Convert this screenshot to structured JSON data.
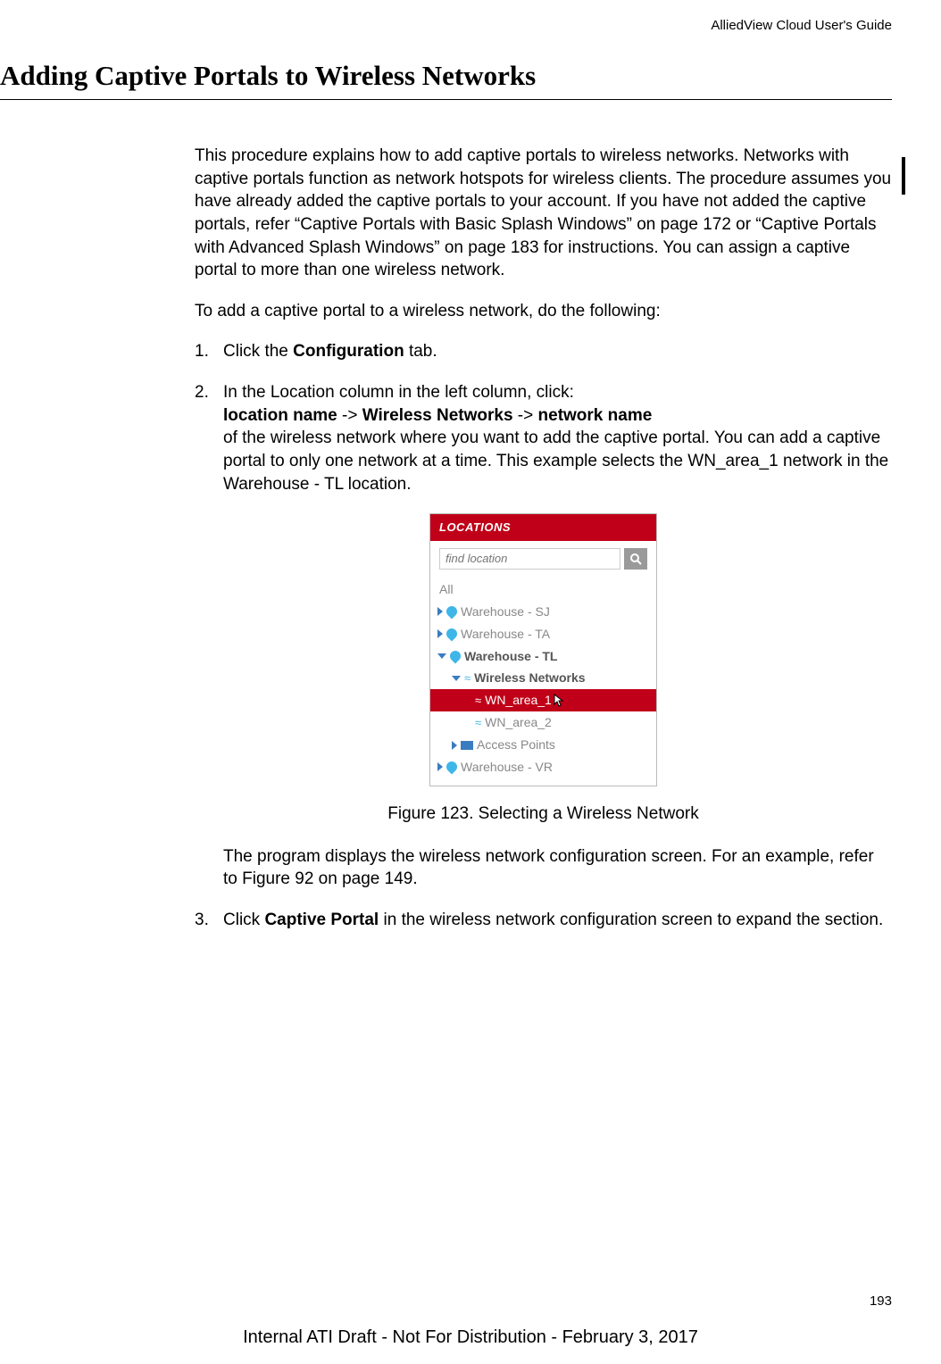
{
  "header": {
    "doc_title": "AlliedView Cloud User's Guide"
  },
  "section": {
    "heading": "Adding Captive Portals to Wireless Networks"
  },
  "intro": {
    "p1": "This procedure explains how to add captive portals to wireless networks. Networks with captive portals function as network hotspots for wireless clients. The procedure assumes you have already added the captive portals to your account. If you have not added the captive portals, refer “Captive Portals with Basic Splash Windows” on page 172 or “Captive Portals with Advanced Splash Windows” on page 183 for instructions. You can assign a captive portal to more than one wireless network.",
    "p2": "To add a captive portal to a wireless network, do the following:"
  },
  "steps": {
    "s1": {
      "num": "1.",
      "pre": "Click the ",
      "bold": "Configuration",
      "post": " tab."
    },
    "s2": {
      "num": "2.",
      "line1": "In the Location column in the left column, click:",
      "b1": "location name",
      "a1": " -> ",
      "b2": "Wireless Networks",
      "a2": " -> ",
      "b3": "network name",
      "rest": "of the wireless network where you want to add the captive portal. You can add a captive portal to only one network at a time. This example selects the WN_area_1 network in the Warehouse - TL location."
    },
    "s3": {
      "num": "3.",
      "pre": "Click ",
      "bold": "Captive Portal",
      "post": " in the wireless network configuration screen to expand the section."
    }
  },
  "figure": {
    "panel_title": "LOCATIONS",
    "search_placeholder": "find location",
    "all_label": "All",
    "items": {
      "sj": "Warehouse - SJ",
      "ta": "Warehouse - TA",
      "tl": "Warehouse - TL",
      "wn": "Wireless Networks",
      "area1": "WN_area_1",
      "area2": "WN_area_2",
      "ap": "Access Points",
      "vr": "Warehouse - VR"
    },
    "caption": "Figure 123. Selecting a Wireless Network",
    "after": "The program displays the wireless network configuration screen. For an example, refer to Figure 92 on page 149."
  },
  "page_number": "193",
  "footer": "Internal ATI Draft - Not For Distribution - February 3, 2017"
}
